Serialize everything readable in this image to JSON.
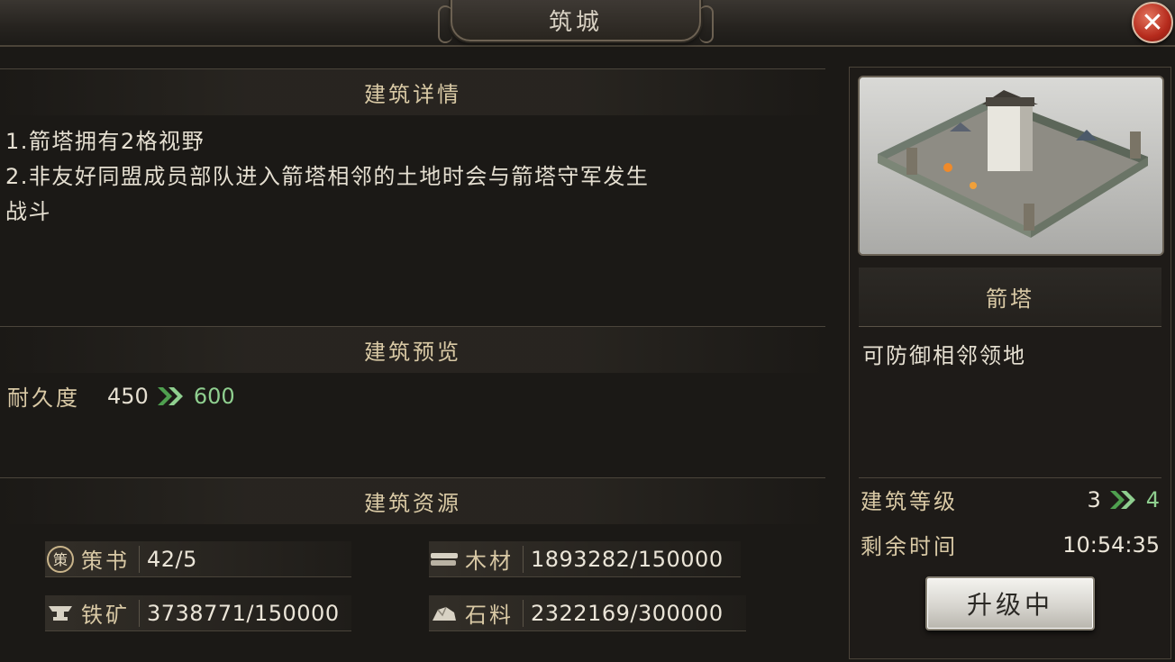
{
  "window": {
    "title": "筑城"
  },
  "detail": {
    "header": "建筑详情",
    "lines": [
      "1.箭塔拥有2格视野",
      "2.非友好同盟成员部队进入箭塔相邻的土地时会与箭塔守军发生",
      "战斗"
    ]
  },
  "preview": {
    "header": "建筑预览",
    "durability_label": "耐久度",
    "durability_from": "450",
    "durability_to": "600"
  },
  "resources": {
    "header": "建筑资源",
    "items": [
      {
        "name": "策书",
        "value": "42/5",
        "icon": "book-seal-icon"
      },
      {
        "name": "木材",
        "value": "1893282/150000",
        "icon": "wood-icon"
      },
      {
        "name": "铁矿",
        "value": "3738771/150000",
        "icon": "anvil-icon"
      },
      {
        "name": "石料",
        "value": "2322169/300000",
        "icon": "stone-icon"
      }
    ]
  },
  "building": {
    "name": "箭塔",
    "description": "可防御相邻领地",
    "level_label": "建筑等级",
    "level_from": "3",
    "level_to": "4",
    "time_label": "剩余时间",
    "time_value": "10:54:35",
    "button_label": "升级中"
  },
  "colors": {
    "accent_green": "#8fcf8f",
    "gold_text": "#d9c9a5",
    "close_red": "#b52a1c"
  }
}
